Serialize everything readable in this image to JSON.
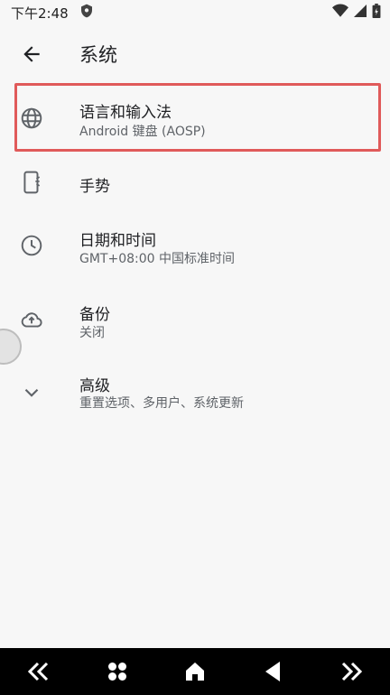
{
  "status_bar": {
    "time": "下午2:48"
  },
  "app_bar": {
    "title": "系统"
  },
  "items": [
    {
      "title": "语言和输入法",
      "summary": "Android 键盘 (AOSP)"
    },
    {
      "title": "手势",
      "summary": ""
    },
    {
      "title": "日期和时间",
      "summary": "GMT+08:00 中国标准时间"
    },
    {
      "title": "备份",
      "summary": "关闭"
    },
    {
      "title": "高级",
      "summary": "重置选项、多用户、系统更新"
    }
  ],
  "colors": {
    "highlight": "#e05a5a",
    "icon": "#5f6368"
  }
}
